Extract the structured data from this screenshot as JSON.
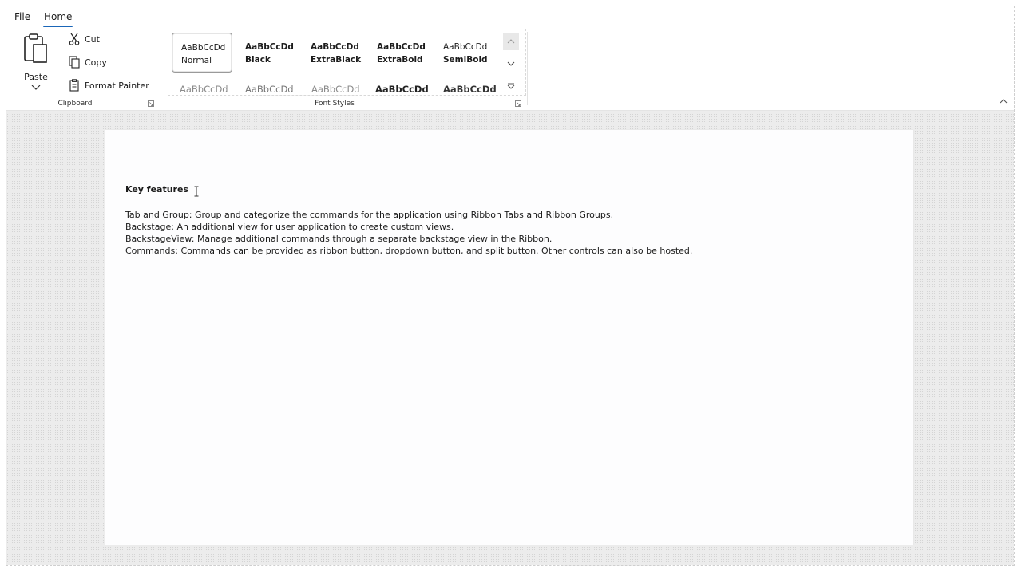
{
  "tabs": [
    {
      "label": "File"
    },
    {
      "label": "Home"
    }
  ],
  "clipboard": {
    "paste_label": "Paste",
    "cut_label": "Cut",
    "copy_label": "Copy",
    "format_painter_label": "Format Painter",
    "group_label": "Clipboard"
  },
  "font_styles": {
    "group_label": "Font Styles",
    "items": [
      {
        "sample": "AaBbCcDd",
        "name": "Normal"
      },
      {
        "sample": "AaBbCcDd",
        "name": "Black"
      },
      {
        "sample": "AaBbCcDd",
        "name": "ExtraBlack"
      },
      {
        "sample": "AaBbCcDd",
        "name": "ExtraBold"
      },
      {
        "sample": "AaBbCcDd",
        "name": "SemiBold"
      }
    ],
    "row2": [
      "AaBbCcDd",
      "AaBbCcDd",
      "AaBbCcDd",
      "AaBbCcDd",
      "AaBbCcDd"
    ]
  },
  "document": {
    "heading": "Key features",
    "lines": [
      "Tab and Group: Group and categorize the commands for the application using Ribbon Tabs and Ribbon Groups.",
      "Backstage: An additional view for user application to create custom views.",
      "BackstageView: Manage additional commands through a separate backstage view in the Ribbon.",
      "Commands: Commands can be provided as ribbon button, dropdown button, and split button. Other controls can also be hosted."
    ]
  },
  "colors": {
    "accent": "#1a66b8",
    "doc_background": "#ececec",
    "page_background": "#fdfdfe"
  },
  "icons": [
    "paste-icon",
    "cut-icon",
    "copy-icon",
    "format-painter-icon",
    "chevron-down-icon",
    "scroll-up-icon",
    "scroll-down-icon",
    "gallery-expand-icon",
    "dialog-launcher-icon",
    "collapse-ribbon-icon",
    "text-cursor-icon"
  ]
}
